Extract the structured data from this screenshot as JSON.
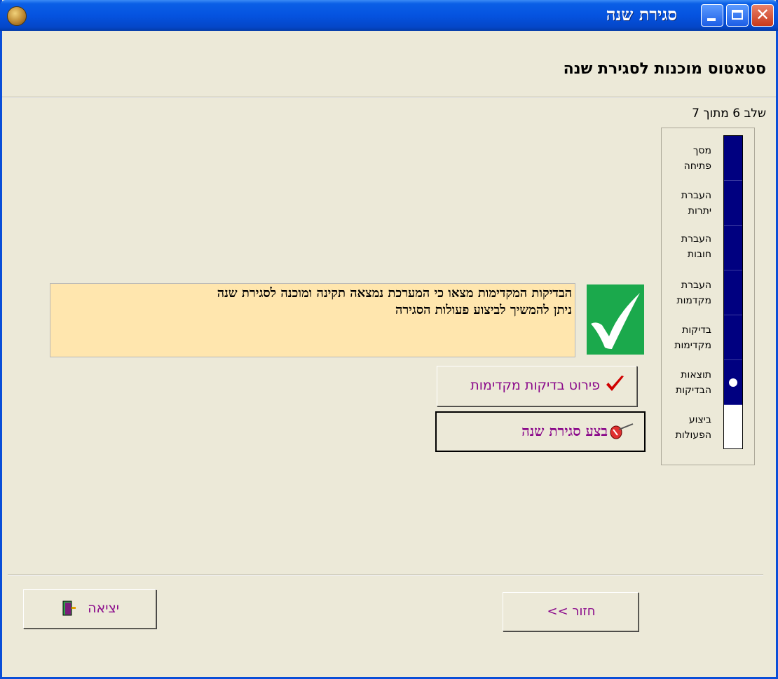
{
  "window": {
    "title": "סגירת שנה"
  },
  "header": {
    "heading": "סטאטוס מוכנות לסגירת שנה"
  },
  "stepper": {
    "label": "שלב 6 מתוך 7",
    "current_step": 6,
    "total_steps": 7,
    "steps": [
      {
        "line1": "מסך",
        "line2": "פתיחה"
      },
      {
        "line1": "העברת",
        "line2": "יתרות"
      },
      {
        "line1": "העברת",
        "line2": "חובות"
      },
      {
        "line1": "העברת",
        "line2": "מקדמות"
      },
      {
        "line1": "בדיקות",
        "line2": "מקדימות"
      },
      {
        "line1": "תוצאות",
        "line2": "הבדיקות"
      },
      {
        "line1": "ביצוע",
        "line2": "הפעולות"
      }
    ],
    "done_color": "#000080"
  },
  "status": {
    "line1": "הבדיקות המקדימות מצאו כי המערכת נמצאה תקינה ומוכנה לסגירת שנה",
    "line2": "ניתן להמשיך לביצוע פעולות הסגירה",
    "icon": "checkmark-icon",
    "tile_color": "#1BA94C",
    "box_color": "#FFE6AE"
  },
  "actions": {
    "details_label": "פירוט בדיקות מקדימות",
    "details_icon": "red-check-icon",
    "close_year_label": "בצע סגירת שנה",
    "close_year_icon": "wand-icon"
  },
  "footer": {
    "exit_label": "יציאה",
    "exit_icon": "door-exit-icon",
    "back_label": "חזור >>"
  }
}
